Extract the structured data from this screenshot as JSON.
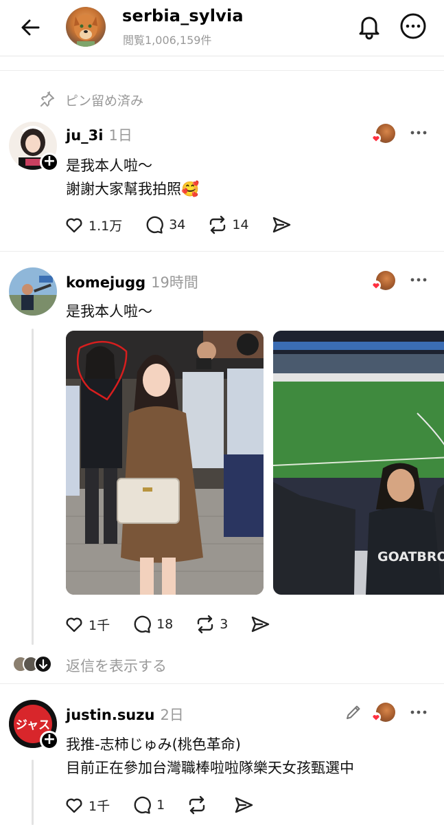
{
  "header": {
    "username": "serbia_sylvia",
    "views": "閲覧1,006,159件"
  },
  "pinned": {
    "label": "ピン留め済み"
  },
  "posts": [
    {
      "username": "ju_3i",
      "time": "1日",
      "lines": [
        "是我本人啦～",
        "謝謝大家幫我拍照🥰"
      ],
      "likes": "1.1万",
      "comments": "34",
      "reposts": "14"
    },
    {
      "username": "komejugg",
      "time": "19時間",
      "lines": [
        "是我本人啦～"
      ],
      "likes": "1千",
      "comments": "18",
      "reposts": "3",
      "photo2_text": "GOATBROS",
      "reply_link": "返信を表示する"
    },
    {
      "username": "justin.suzu",
      "time": "2日",
      "avatar_text": "ジャス",
      "lines": [
        "我推-志柿じゅみ(桃色革命)",
        "目前正在參加台灣職棒啦啦隊樂天女孩甄選中"
      ],
      "likes": "1千",
      "comments": "1",
      "reposts": ""
    }
  ]
}
